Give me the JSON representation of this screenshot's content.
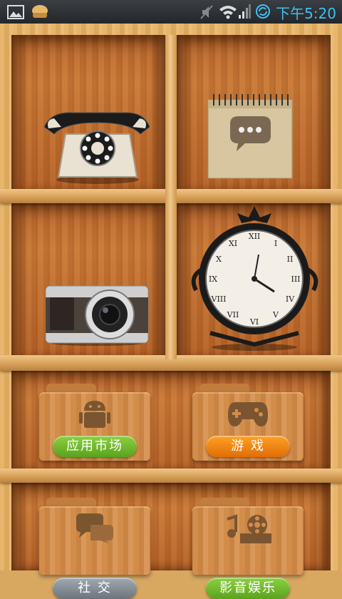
{
  "status_bar": {
    "time": "下午5:20",
    "icons": [
      "gallery-icon",
      "app-notification-icon",
      "mute-icon",
      "wifi-icon",
      "signal-icon",
      "sync-icon"
    ]
  },
  "shelf": {
    "items": [
      {
        "name": "phone",
        "icon": "rotary-telephone"
      },
      {
        "name": "messaging",
        "icon": "notepad-speech-bubble"
      },
      {
        "name": "camera",
        "icon": "camera"
      },
      {
        "name": "clock",
        "icon": "ornate-clock"
      }
    ],
    "folders": [
      {
        "label": "应用市场",
        "color": "#6cb82b",
        "icon": "android-icon"
      },
      {
        "label": "游 戏",
        "color": "#f08a12",
        "icon": "gamepad-icon"
      },
      {
        "label": "社 交",
        "color": "#848d95",
        "icon": "chat-bubbles-icon"
      },
      {
        "label": "影音娱乐",
        "color": "#6cb82b",
        "icon": "film-music-icon"
      }
    ]
  }
}
